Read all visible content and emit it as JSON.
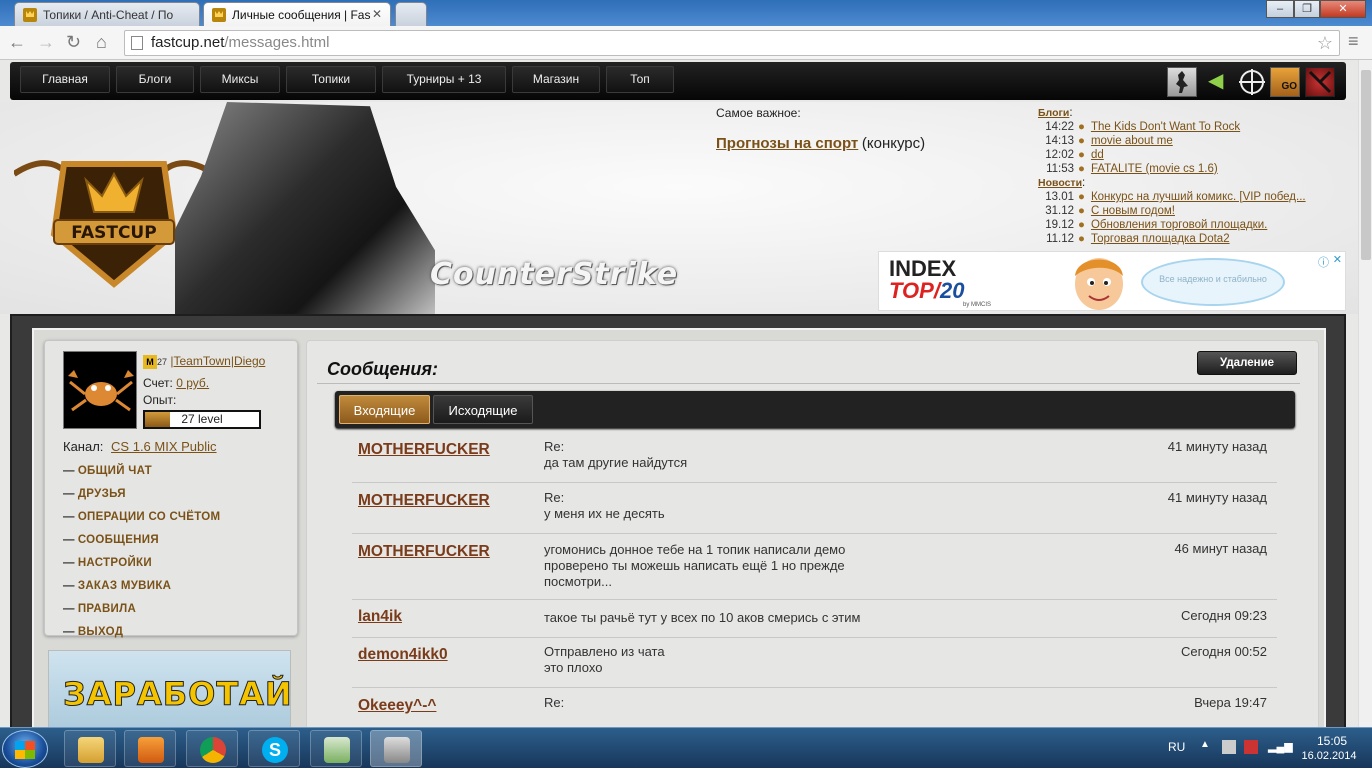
{
  "browser": {
    "tabs": [
      {
        "title": "Топики / Anti-Cheat / По"
      },
      {
        "title": "Личные сообщения | Fas"
      }
    ],
    "url_host": "fastcup.net",
    "url_path": "/messages.html"
  },
  "nav": {
    "items": [
      "Главная",
      "Блоги",
      "Миксы",
      "Топики",
      "Турниры + 13",
      "Магазин",
      "Топ"
    ],
    "game_icons": [
      "cs-icon",
      "arrow-left-icon",
      "crosshair-icon",
      "csgo-icon",
      "dota2-icon"
    ],
    "csgo_label": "GO"
  },
  "header": {
    "logo_text": "FASTCUP",
    "title": "CounterStrike",
    "important_label": "Самое важное:",
    "important_link": "Прогнозы на спорт",
    "important_suffix": "(конкурс)",
    "blogs_label": "Блоги",
    "blogs": [
      {
        "time": "14:22",
        "title": "The Kids Don't Want To Rock"
      },
      {
        "time": "14:13",
        "title": "movie about me"
      },
      {
        "time": "12:02",
        "title": "dd"
      },
      {
        "time": "11:53",
        "title": "FATALITE (movie cs 1.6)"
      }
    ],
    "news_label": "Новости",
    "news": [
      {
        "time": "13.01",
        "title": "Конкурс на лучший комикс. [VIP побед..."
      },
      {
        "time": "31.12",
        "title": "С новым годом!"
      },
      {
        "time": "19.12",
        "title": "Обновления торговой площадки."
      },
      {
        "time": "11.12",
        "title": "Торговая площадка Dota2"
      }
    ],
    "ad_line1": "INDEX",
    "ad_line2": "TOP",
    "ad_line3": "20",
    "ad_small": "by MMCIS",
    "ad_bubble": "Все надежно и стабильно"
  },
  "user": {
    "level_badge": "M",
    "level_num": "27",
    "name": "|TeamTown|Diego",
    "account_label": "Счет:",
    "account_value": "0 руб.",
    "exp_label": "Опыт:",
    "exp_level": "27 level",
    "exp_fraction": 0.22,
    "channel_label": "Канал:",
    "channel": "CS 1.6 MIX Public"
  },
  "menu": [
    "ОБЩИЙ ЧАТ",
    "ДРУЗЬЯ",
    "ОПЕРАЦИИ СО СЧЁТОМ",
    "СООБЩЕНИЯ",
    "НАСТРОЙКИ",
    "ЗАКАЗ МУВИКА",
    "ПРАВИЛА",
    "ВЫХОД"
  ],
  "banner": "ЗАРАБОТАЙ",
  "messages": {
    "title": "Сообщения:",
    "delete": "Удаление",
    "tab_inbox": "Входящие",
    "tab_outbox": "Исходящие",
    "items": [
      {
        "from": "MOTHERFUCKER",
        "subject": "Re:",
        "body": "да там другие найдутся",
        "time": "41 минуту назад"
      },
      {
        "from": "MOTHERFUCKER",
        "subject": "Re:",
        "body": "у меня их не десять",
        "time": "41 минуту назад"
      },
      {
        "from": "MOTHERFUCKER",
        "subject": "",
        "body": "угомонись донное тебе на 1 топик написали демо проверено ты можешь написать ещё 1 но прежде посмотри...",
        "time": "46 минут назад"
      },
      {
        "from": "lan4ik",
        "subject": "",
        "body": "такое ты рачьё тут у всех по 10 аков смерись с этим",
        "time": "Сегодня 09:23"
      },
      {
        "from": "demon4ikk0",
        "subject": "Отправлено из чата",
        "body": "это плохо",
        "time": "Сегодня 00:52"
      },
      {
        "from": "Okeeey^-^",
        "subject": "Re:",
        "body": "",
        "time": "Вчера 19:47"
      }
    ]
  },
  "taskbar": {
    "lang": "RU",
    "time": "15:05",
    "date": "16.02.2014"
  }
}
